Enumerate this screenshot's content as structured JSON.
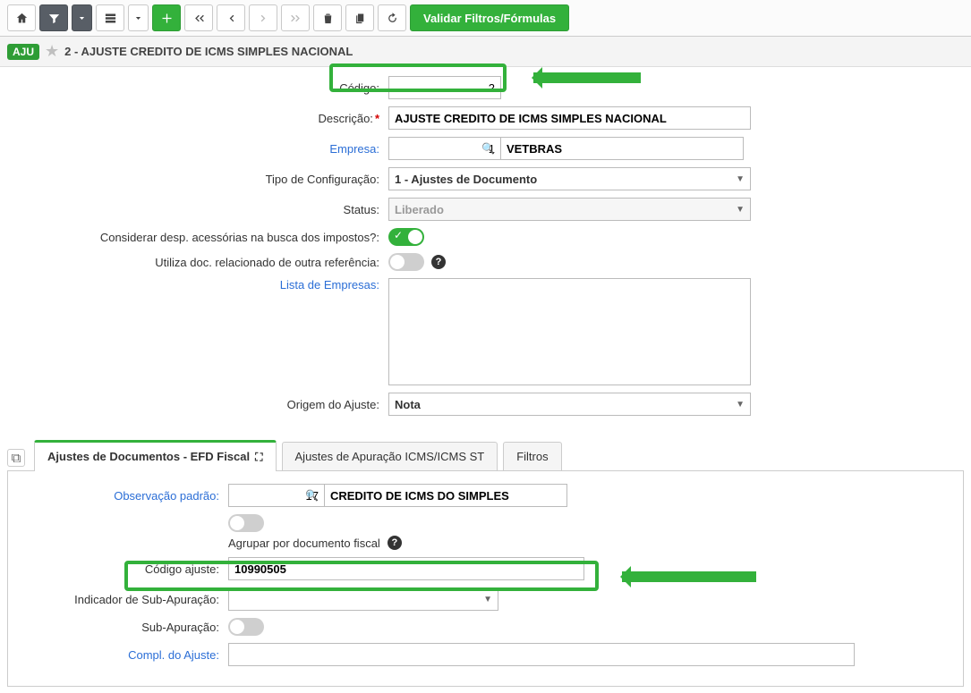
{
  "toolbar": {
    "validate_label": "Validar Filtros/Fórmulas"
  },
  "header": {
    "badge": "AJU",
    "title": "2 - AJUSTE CREDITO DE ICMS SIMPLES NACIONAL"
  },
  "form": {
    "codigo_label": "Código:",
    "codigo": "2",
    "descricao_label": "Descrição:",
    "descricao": "AJUSTE CREDITO DE ICMS SIMPLES NACIONAL",
    "empresa_label": "Empresa:",
    "empresa_code": "1",
    "empresa_name": "VETBRAS",
    "tipo_label": "Tipo de Configuração:",
    "tipo": "1 - Ajustes de Documento",
    "status_label": "Status:",
    "status": "Liberado",
    "desp_label": "Considerar desp. acessórias na busca dos impostos?:",
    "doc_rel_label": "Utiliza doc. relacionado de outra referência:",
    "lista_emp_label": "Lista de Empresas:",
    "origem_label": "Origem do Ajuste:",
    "origem": "Nota"
  },
  "tabs": {
    "t1": "Ajustes de Documentos - EFD Fiscal",
    "t2": "Ajustes de Apuração ICMS/ICMS ST",
    "t3": "Filtros"
  },
  "tab1": {
    "obs_label": "Observação padrão:",
    "obs_code": "17",
    "obs_desc": "CREDITO DE ICMS DO SIMPLES",
    "agrupar_label": "Agrupar por documento fiscal",
    "cod_ajuste_label": "Código ajuste:",
    "cod_ajuste": "10990505",
    "ind_sub_label": "Indicador de Sub-Apuração:",
    "sub_label": "Sub-Apuração:",
    "compl_label": "Compl. do Ajuste:"
  }
}
